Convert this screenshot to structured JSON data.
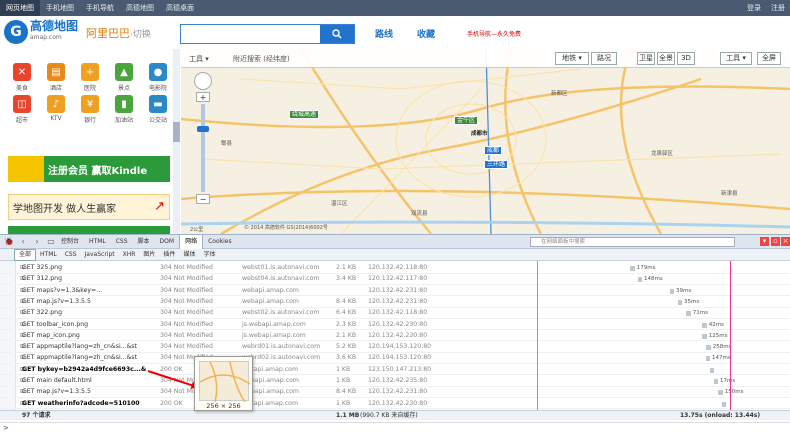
{
  "topbar": {
    "nav": [
      "网页地图",
      "手机地图",
      "手机导航",
      "高德地图",
      "高德桌面"
    ],
    "active_index": 0,
    "right": [
      "登录",
      "注册"
    ]
  },
  "header": {
    "logo_mark": "G",
    "logo_title": "高德地图",
    "logo_sub": "amap.com",
    "city": "阿里巴巴",
    "city_change": "·切换",
    "search_placeholder": "",
    "search_button_icon": "search-icon",
    "links": [
      "路线",
      "收藏"
    ],
    "promo": "手机导航—永久免费"
  },
  "sidebar": {
    "categories": [
      {
        "label": "美食",
        "icon": "utensils-icon",
        "color": "#e8452c"
      },
      {
        "label": "酒店",
        "icon": "hotel-icon",
        "color": "#e88a1a"
      },
      {
        "label": "医院",
        "icon": "hospital-icon",
        "color": "#f0a020"
      },
      {
        "label": "景点",
        "icon": "scenery-icon",
        "color": "#4aa53a"
      },
      {
        "label": "电影院",
        "icon": "film-icon",
        "color": "#2a8ac8"
      },
      {
        "label": "超市",
        "icon": "basket-icon",
        "color": "#e8452c"
      },
      {
        "label": "KTV",
        "icon": "mic-icon",
        "color": "#f0a020"
      },
      {
        "label": "银行",
        "icon": "yen-icon",
        "color": "#f0a020"
      },
      {
        "label": "加油站",
        "icon": "fuel-icon",
        "color": "#4aa53a"
      },
      {
        "label": "公交站",
        "icon": "bus-icon",
        "color": "#2a8ac8"
      }
    ],
    "banner1": "注册会员 赢取Kindle",
    "banner2": "学地图开发 做人生赢家"
  },
  "map": {
    "toolbar_left": "工具 ▾",
    "coord_text": "附近搜索 (经纬度)",
    "buttons": [
      "地铁 ▾",
      "路况",
      "卫星",
      "全景",
      "3D",
      "工具 ▾",
      "全屏"
    ],
    "road_signs": [
      "绕城高速",
      "金牛区",
      "成都",
      "三环路"
    ],
    "labels": [
      "郫县",
      "温江区",
      "新都区",
      "龙泉驿区",
      "双流县",
      "新津县",
      "成都市"
    ],
    "copyright": "© 2014 高德软件 GS(2014)6002号",
    "scale": "2公里"
  },
  "devtools": {
    "tabs": [
      "控制台",
      "HTML",
      "CSS",
      "脚本",
      "DOM",
      "网络",
      "Cookies"
    ],
    "active_tab": "网络",
    "search_placeholder": "在网络面板中搜索",
    "filters": [
      "全部",
      "HTML",
      "CSS",
      "JavaScript",
      "XHR",
      "图片",
      "插件",
      "媒体",
      "字体"
    ],
    "active_filter": "全部",
    "rows": [
      {
        "url": "GET 325.png",
        "status": "304 Not Modified",
        "domain": "webst01.is.autonavi.com",
        "size": "2.1 KB",
        "ip": "120.132.42.118:80",
        "start": 0.6,
        "width": 0.012,
        "time": "179ms",
        "bold": false
      },
      {
        "url": "GET 312.png",
        "status": "304 Not Modified",
        "domain": "webst04.is.autonavi.com",
        "size": "3.4 KB",
        "ip": "120.132.42.117:80",
        "start": 0.62,
        "width": 0.01,
        "time": "148ms",
        "bold": false
      },
      {
        "url": "GET maps?v=1.3&key=...",
        "status": "304 Not Modified",
        "domain": "webapi.amap.com",
        "size": "",
        "ip": "120.132.42.231:80",
        "start": 0.7,
        "width": 0.008,
        "time": "39ms",
        "bold": false
      },
      {
        "url": "GET map.js?v=1.3.5.5",
        "status": "304 Not Modified",
        "domain": "webapi.amap.com",
        "size": "8.4 KB",
        "ip": "120.132.42.231:80",
        "start": 0.72,
        "width": 0.01,
        "time": "35ms",
        "bold": false
      },
      {
        "url": "GET 322.png",
        "status": "304 Not Modified",
        "domain": "webst02.is.autonavi.com",
        "size": "6.4 KB",
        "ip": "120.132.42.118:80",
        "start": 0.74,
        "width": 0.012,
        "time": "71ms",
        "bold": false
      },
      {
        "url": "GET toolbar_icon.png",
        "status": "304 Not Modified",
        "domain": "js.webapi.amap.com",
        "size": "2.3 KB",
        "ip": "120.132.42.230:80",
        "start": 0.78,
        "width": 0.012,
        "time": "42ms",
        "bold": false
      },
      {
        "url": "GET map_icon.png",
        "status": "304 Not Modified",
        "domain": "js.webapi.amap.com",
        "size": "2.1 KB",
        "ip": "120.132.42.230:80",
        "start": 0.78,
        "width": 0.012,
        "time": "125ms",
        "bold": false
      },
      {
        "url": "GET appmaptile?lang=zh_cn&si...&st",
        "status": "304 Not Modified",
        "domain": "webrd01.is.autonavi.com",
        "size": "5.2 KB",
        "ip": "120.194.153.120:80",
        "start": 0.79,
        "width": 0.012,
        "time": "258ms",
        "bold": false
      },
      {
        "url": "GET appmaptile?lang=zh_cn&si...&st",
        "status": "304 Not Modified",
        "domain": "webrd02.is.autonavi.com",
        "size": "3.6 KB",
        "ip": "120.194.153.120:80",
        "start": 0.79,
        "width": 0.01,
        "time": "147ms",
        "bold": false
      },
      {
        "url": "GET bykey=b2942a4d9fce6693c...&",
        "status": "200 OK",
        "domain": "restapi.amap.com",
        "size": "1 KB",
        "ip": "123.150.147.213:80",
        "start": 0.8,
        "width": 0.01,
        "time": "",
        "bold": true
      },
      {
        "url": "GET main default.html",
        "status": "304 Not Modified",
        "domain": "webapi.amap.com",
        "size": "1 KB",
        "ip": "120.132.42.235:80",
        "start": 0.81,
        "width": 0.01,
        "time": "17ms",
        "bold": false
      },
      {
        "url": "GET map.js?v=1.3.5.5",
        "status": "304 Not Modified",
        "domain": "webapi.amap.com",
        "size": "8.4 KB",
        "ip": "120.132.42.231:80",
        "start": 0.82,
        "width": 0.012,
        "time": "150ms",
        "bold": false
      },
      {
        "url": "GET weatherinfo?adcode=510100",
        "status": "200 OK",
        "domain": "restapi.amap.com",
        "size": "1 KB",
        "ip": "120.132.42.230:80",
        "start": 0.83,
        "width": 0.01,
        "time": "",
        "bold": true
      }
    ],
    "footer_count": "97 个请求",
    "footer_size": "1.1 MB",
    "footer_cache": "(990.7 KB 来自缓存)",
    "footer_time": "13.75s (onload: 13.44s)",
    "tooltip_caption": "256 × 256"
  },
  "statusbar": {
    "text": ">"
  }
}
